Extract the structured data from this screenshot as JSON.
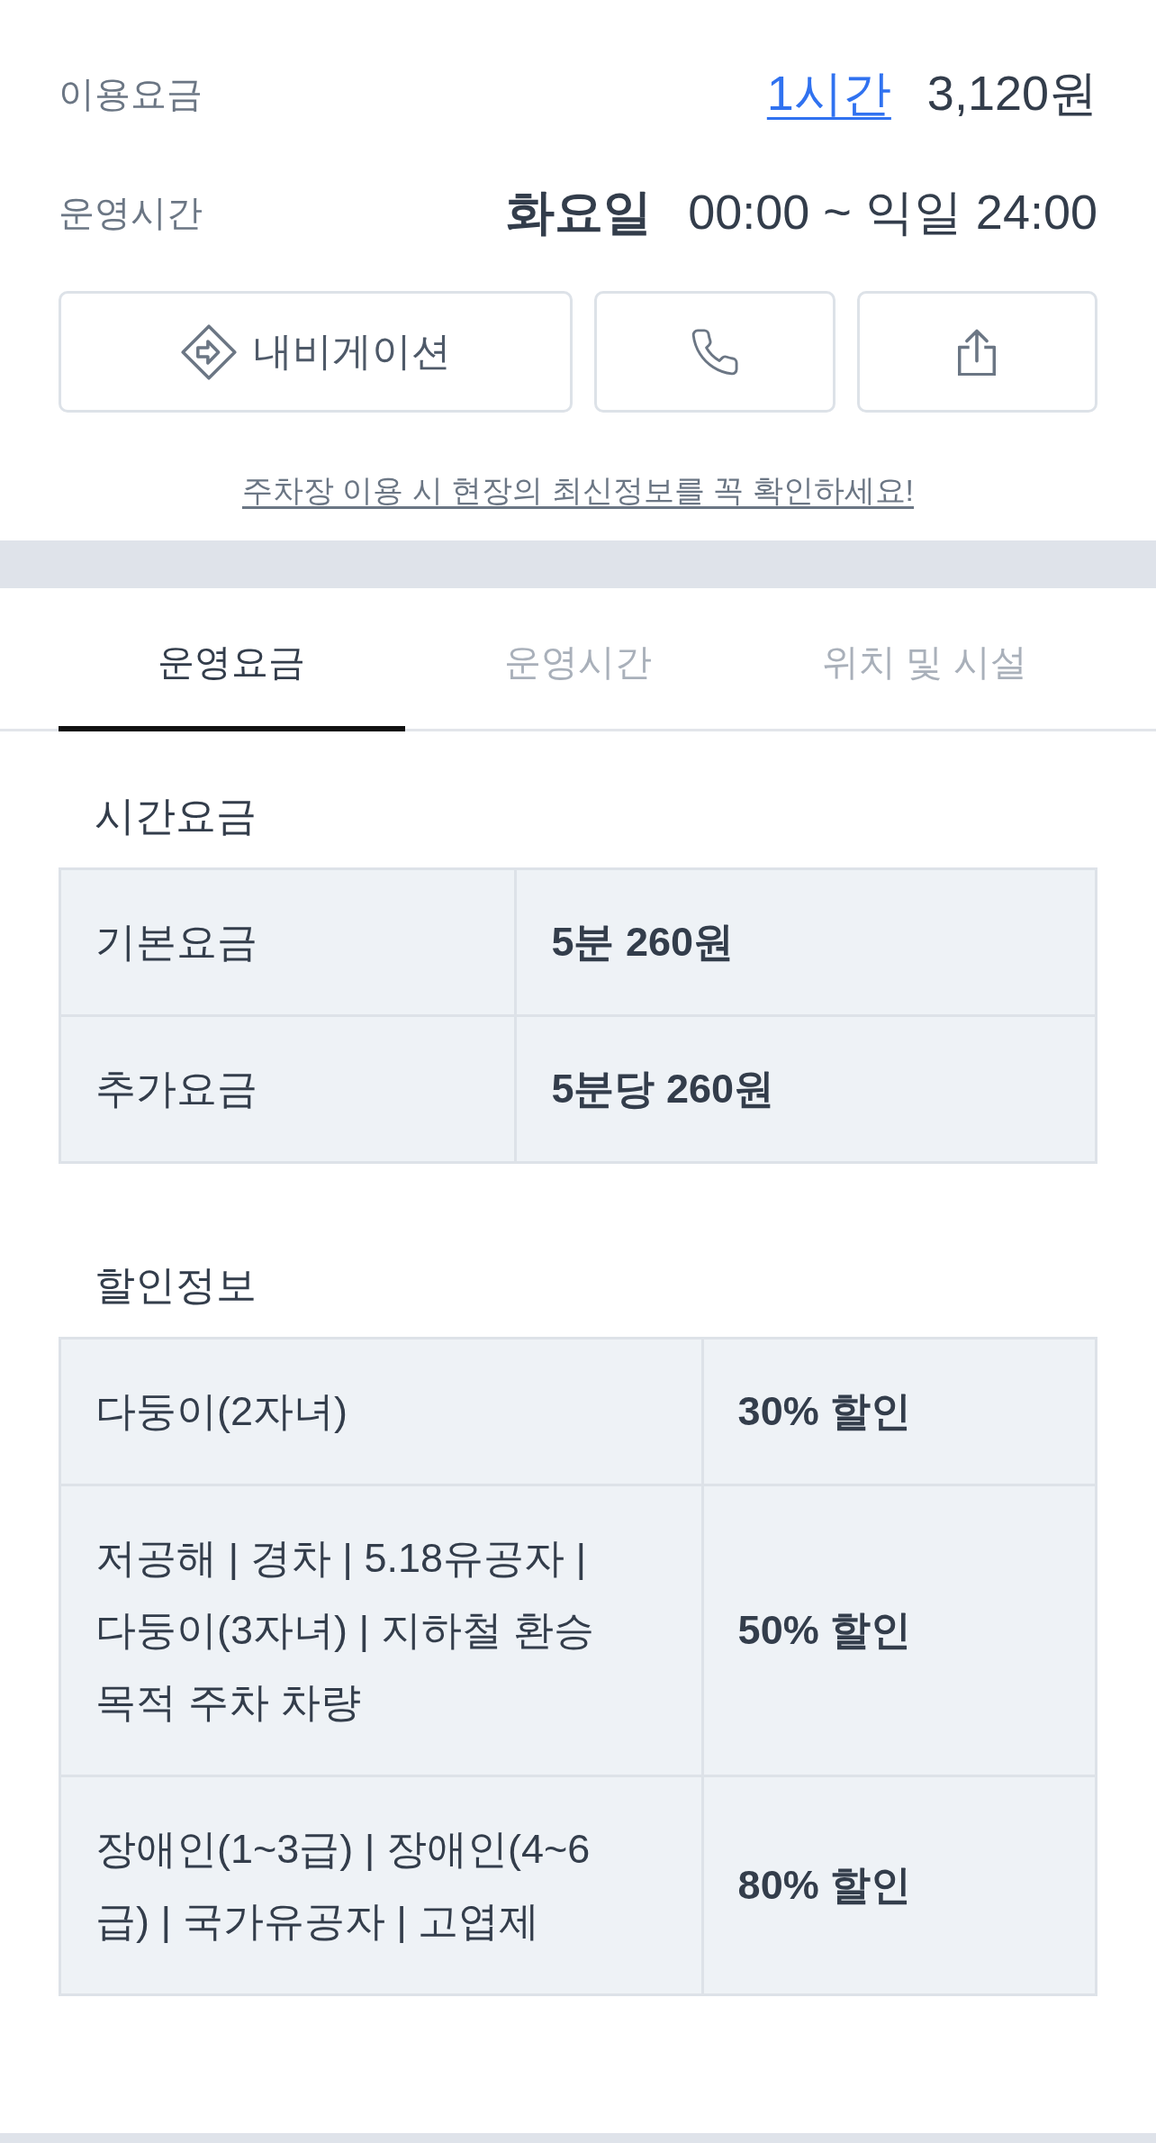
{
  "fee": {
    "label": "이용요금",
    "duration": "1시간",
    "amount": "3,120원"
  },
  "hours": {
    "label": "운영시간",
    "day": "화요일",
    "range": "00:00 ~ 익일 24:00"
  },
  "actions": [
    {
      "kind": "navigation",
      "label": "내비게이션"
    },
    {
      "kind": "call"
    },
    {
      "kind": "share"
    }
  ],
  "notice": "주차장 이용 시 현장의 최신정보를 꼭 확인하세요!",
  "tabs": [
    {
      "label": "운영요금",
      "selected": true
    },
    {
      "label": "운영시간",
      "selected": false
    },
    {
      "label": "위치 및 시설",
      "selected": false
    }
  ],
  "sections": [
    {
      "kind": "fees",
      "title": "시간요금",
      "rows": [
        {
          "name": "기본요금",
          "value": "5분 260원"
        },
        {
          "name": "추가요금",
          "value": "5분당 260원"
        }
      ]
    },
    {
      "kind": "discounts",
      "title": "할인정보",
      "rows": [
        {
          "name": "다둥이(2자녀)",
          "value": "30% 할인"
        },
        {
          "name": "저공해 | 경차 | 5.18유공자 | 다둥이(3자녀) | 지하철 환승 목적 주차 차량",
          "value": "50% 할인"
        },
        {
          "name": "장애인(1~3급) | 장애인(4~6급) | 국가유공자 | 고엽제",
          "value": "80% 할인"
        }
      ]
    }
  ]
}
